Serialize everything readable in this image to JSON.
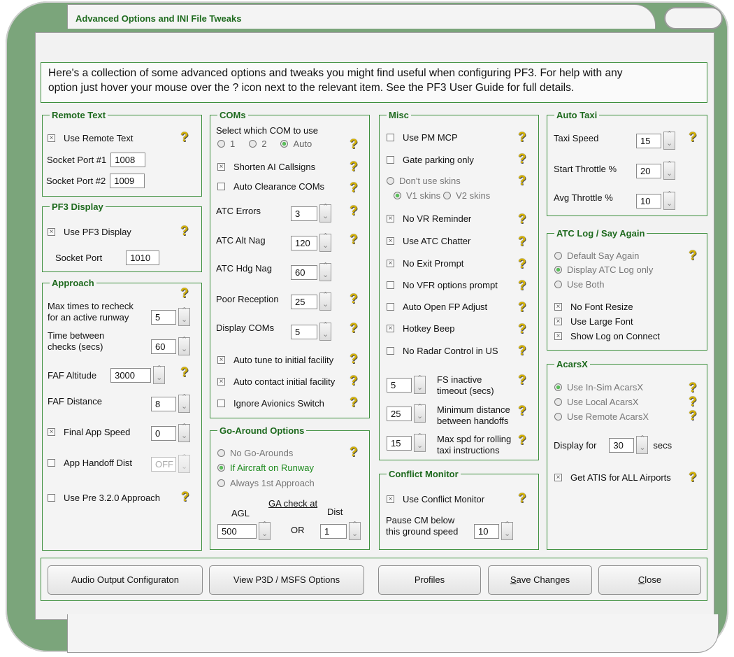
{
  "window": {
    "title": "Advanced Options and INI File Tweaks"
  },
  "intro": {
    "line1": "Here's a collection of some advanced options and tweaks you might find useful when configuring PF3. For help with any",
    "line2": "option just hover your mouse over the ? icon next to the relevant item. See the PF3 User Guide for full details."
  },
  "help_glyph": "?",
  "remote_text": {
    "title": "Remote Text",
    "use_label": "Use Remote Text",
    "use_checked": true,
    "port1_label": "Socket Port #1",
    "port1_value": "1008",
    "port2_label": "Socket Port #2",
    "port2_value": "1009"
  },
  "pf3_display": {
    "title": "PF3 Display",
    "use_label": "Use PF3 Display",
    "use_checked": true,
    "port_label": "Socket Port",
    "port_value": "1010"
  },
  "approach": {
    "title": "Approach",
    "max_label_1": "Max times to recheck",
    "max_label_2": "for an active runway",
    "max_value": "5",
    "time_label_1": "Time between",
    "time_label_2": "checks (secs)",
    "time_value": "60",
    "faf_alt_label": "FAF Altitude",
    "faf_alt_value": "3000",
    "faf_dist_label": "FAF Distance",
    "faf_dist_value": "8",
    "final_speed_label": "Final App Speed",
    "final_speed_checked": true,
    "final_speed_value": "0",
    "handoff_label": "App Handoff Dist",
    "handoff_checked": false,
    "handoff_value": "OFF",
    "pre320_label": "Use Pre 3.2.0 Approach",
    "pre320_checked": false
  },
  "coms": {
    "title": "COMs",
    "select_label": "Select which COM to use",
    "options": [
      "1",
      "2",
      "Auto"
    ],
    "selected": "Auto",
    "shorten_label": "Shorten AI Callsigns",
    "shorten_checked": true,
    "auto_clear_label": "Auto Clearance COMs",
    "auto_clear_checked": false,
    "atc_errors_label": "ATC Errors",
    "atc_errors_value": "3",
    "atc_alt_label": "ATC Alt Nag",
    "atc_alt_value": "120",
    "atc_hdg_label": "ATC Hdg Nag",
    "atc_hdg_value": "60",
    "poor_label": "Poor Reception",
    "poor_value": "25",
    "display_label": "Display COMs",
    "display_value": "5",
    "auto_tune_label": "Auto tune to initial facility",
    "auto_tune_checked": true,
    "auto_contact_label": "Auto contact initial facility",
    "auto_contact_checked": true,
    "ignore_label": "Ignore Avionics Switch",
    "ignore_checked": false
  },
  "go_around": {
    "title": "Go-Around Options",
    "opt1": "No Go-Arounds",
    "opt2": "If Aircraft on Runway",
    "opt3": "Always 1st Approach",
    "selected": "If Aircraft on Runway",
    "ga_check_label": "GA check at",
    "agl_label": "AGL",
    "dist_label": "Dist",
    "or_label": "OR",
    "agl_value": "500",
    "dist_value": "1"
  },
  "misc": {
    "title": "Misc",
    "pm_mcp": "Use PM MCP",
    "pm_mcp_checked": false,
    "gate": "Gate parking only",
    "gate_checked": false,
    "skins": "Don't use skins",
    "v1": "V1 skins",
    "v2": "V2 skins",
    "skin_selected": "V1 skins",
    "vr": "No VR Reminder",
    "vr_checked": true,
    "chatter": "Use ATC Chatter",
    "chatter_checked": true,
    "exit": "No Exit Prompt",
    "exit_checked": true,
    "vfr": "No VFR options  prompt",
    "vfr_checked": false,
    "fp": "Auto Open FP Adjust",
    "fp_checked": false,
    "beep": "Hotkey Beep",
    "beep_checked": true,
    "radar": "No Radar Control in US",
    "radar_checked": false,
    "inactive_value": "5",
    "inactive_label_1": "FS inactive",
    "inactive_label_2": "timeout (secs)",
    "min_dist_value": "25",
    "min_dist_label_1": "Minimum distance",
    "min_dist_label_2": "between handoffs",
    "max_spd_value": "15",
    "max_spd_label_1": "Max spd for rolling",
    "max_spd_label_2": "taxi instructions"
  },
  "conflict": {
    "title": "Conflict Monitor",
    "use_label": "Use Conflict Monitor",
    "use_checked": true,
    "pause_label_1": "Pause CM below",
    "pause_label_2": "this ground speed",
    "pause_value": "10"
  },
  "auto_taxi": {
    "title": "Auto Taxi",
    "speed_label": "Taxi Speed",
    "speed_value": "15",
    "start_label": "Start Throttle %",
    "start_value": "20",
    "avg_label": "Avg Throttle  %",
    "avg_value": "10"
  },
  "atc_log": {
    "title": "ATC Log / Say Again",
    "opt1": "Default Say Again",
    "opt2": "Display ATC Log only",
    "opt3": "Use Both",
    "selected": "Display ATC Log only",
    "font_resize": "No Font Resize",
    "font_resize_checked": true,
    "large_font": "Use Large Font",
    "large_font_checked": true,
    "show_log": "Show Log on Connect",
    "show_log_checked": true
  },
  "acarsx": {
    "title": "AcarsX",
    "opt1": "Use In-Sim AcarsX",
    "opt2": "Use Local AcarsX",
    "opt3": "Use Remote AcarsX",
    "selected": "Use In-Sim AcarsX",
    "display_label": "Display for",
    "display_value": "30",
    "secs_label": "secs",
    "atis_label": "Get ATIS for ALL Airports",
    "atis_checked": true
  },
  "buttons": {
    "audio": "Audio Output Configuraton",
    "p3d": "View P3D / MSFS Options",
    "profiles": "Profiles",
    "save_ul": "S",
    "save_rest": "ave Changes",
    "close_ul": "C",
    "close_rest": "lose"
  },
  "colors": {
    "frame": "#7ba57b",
    "group_border": "#3d8f3d",
    "legend": "#1e6a1e",
    "help_icon": "#d8b400",
    "radio_on": "#5bbd5b"
  }
}
